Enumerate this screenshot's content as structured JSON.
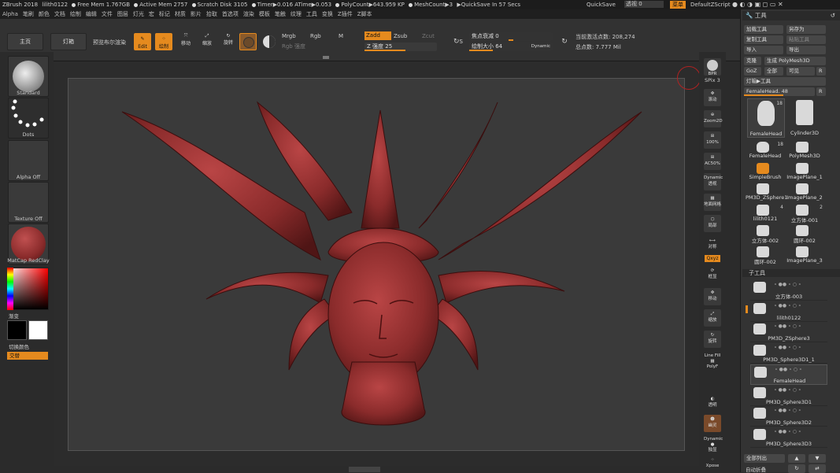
{
  "title": {
    "app": "ZBrush 2018",
    "file": "lilith0122",
    "free_mem": "Free Mem 1.767GB",
    "active_mem": "Active Mem 2757",
    "scratch": "Scratch Disk 3105",
    "timer": "Timer▶0.016 ATime▶0.053",
    "polycount": "PolyCount▶643.959 KP",
    "meshcount": "MeshCount▶3",
    "quicksave": "▶QuickSave In 57 Secs"
  },
  "topright": {
    "quicksave": "QuickSave",
    "transparency": "透视 0",
    "menu": "菜单",
    "script": "DefaultZScript"
  },
  "menu": [
    "Alpha",
    "笔刷",
    "颜色",
    "文档",
    "绘制",
    "编辑",
    "文件",
    "图层",
    "灯光",
    "宏",
    "标记",
    "材质",
    "影片",
    "拾取",
    "首选项",
    "渲染",
    "模板",
    "笔触",
    "纹理",
    "工具",
    "变换",
    "Z插件",
    "Z脚本"
  ],
  "shelf": {
    "home": "主页",
    "lightbox": "灯箱",
    "preview": "预览布尔渲染",
    "edit": "Edit",
    "draw": "绘制",
    "move": "移动",
    "scale": "缩放",
    "rotate": "旋转",
    "mrgb": "Mrgb",
    "rgb": "Rgb",
    "m": "M",
    "rgb_intensity": "Rgb 强度",
    "zadd": "Zadd",
    "zsub": "Zsub",
    "zcut": "Zcut",
    "z_intensity": "Z 强度 25",
    "focal": "焦点衰减 0",
    "draw_size": "绘制大小 64",
    "dynamic": "Dynamic",
    "active_points": "当前激活点数: 208,274",
    "total_points": "总点数: 7.777 Mil",
    "brush_s": "S"
  },
  "left": {
    "brush": "Standard",
    "stroke": "Dots",
    "alpha": "Alpha Off",
    "texture": "Texture Off",
    "material": "MatCap RedClay",
    "gradient": "渐变",
    "switch_color": "切换颜色",
    "alternate": "交替"
  },
  "rightstrip": {
    "bpr": "BPR",
    "spix": "SPix 3",
    "scroll": "滚动",
    "zoom2d": "Zoom2D",
    "pct100": "100%",
    "ac50": "AC50%",
    "dynamic": "Dynamic",
    "perspective": "透视",
    "floor": "地面网格",
    "local": "局部",
    "symmetry": "对称",
    "xyz": "Qxyz",
    "frame": "框显",
    "move": "移动",
    "scale": "缩放",
    "rotate": "旋转",
    "linefill": "Line Fill",
    "polyf": "PolyF",
    "transp": "透明",
    "ghost": "幽灵",
    "dynamic2": "Dynamic",
    "solo": "独显",
    "xpose": "Xpose"
  },
  "tool": {
    "header": "工具",
    "load": "加载工具",
    "saveas": "另存为",
    "copy": "复制工具",
    "paste": "粘贴工具",
    "import": "导入",
    "export": "导出",
    "clone": "克隆",
    "polymesh": "生成 PolyMesh3D",
    "goz": "GoZ",
    "all": "全部",
    "visible": "可见",
    "r": "R",
    "lightbox": "灯箱▶工具",
    "current": "FemaleHead. 48",
    "items": [
      {
        "name": "FemaleHead",
        "count": "18"
      },
      {
        "name": "Cylinder3D",
        "count": ""
      },
      {
        "name": "FemaleHead",
        "count": "18"
      },
      {
        "name": "PolyMesh3D",
        "count": ""
      },
      {
        "name": "SimpleBrush",
        "count": ""
      },
      {
        "name": "ImagePlane_1",
        "count": ""
      },
      {
        "name": "PM3D_ZSphere1",
        "count": ""
      },
      {
        "name": "ImagePlane_2",
        "count": ""
      },
      {
        "name": "lilith0121",
        "count": "4"
      },
      {
        "name": "立方体-001",
        "count": "2"
      },
      {
        "name": "立方体-002",
        "count": ""
      },
      {
        "name": "圆环-002",
        "count": ""
      },
      {
        "name": "圆环-002",
        "count": ""
      },
      {
        "name": "ImagePlane_3",
        "count": ""
      }
    ],
    "subtool_header": "子工具",
    "subtools": [
      "立方体-003",
      "lilith0122",
      "PM3D_ZSphere3",
      "PM3D_Sphere3D1_1",
      "FemaleHead",
      "PM3D_Sphere3D1",
      "PM3D_Sphere3D2",
      "PM3D_Sphere3D3"
    ],
    "list_all": "全部列出",
    "auto_collapse": "自动折叠"
  },
  "colors": {
    "accent": "#e58a1e",
    "clay": "#8a2b2b"
  }
}
